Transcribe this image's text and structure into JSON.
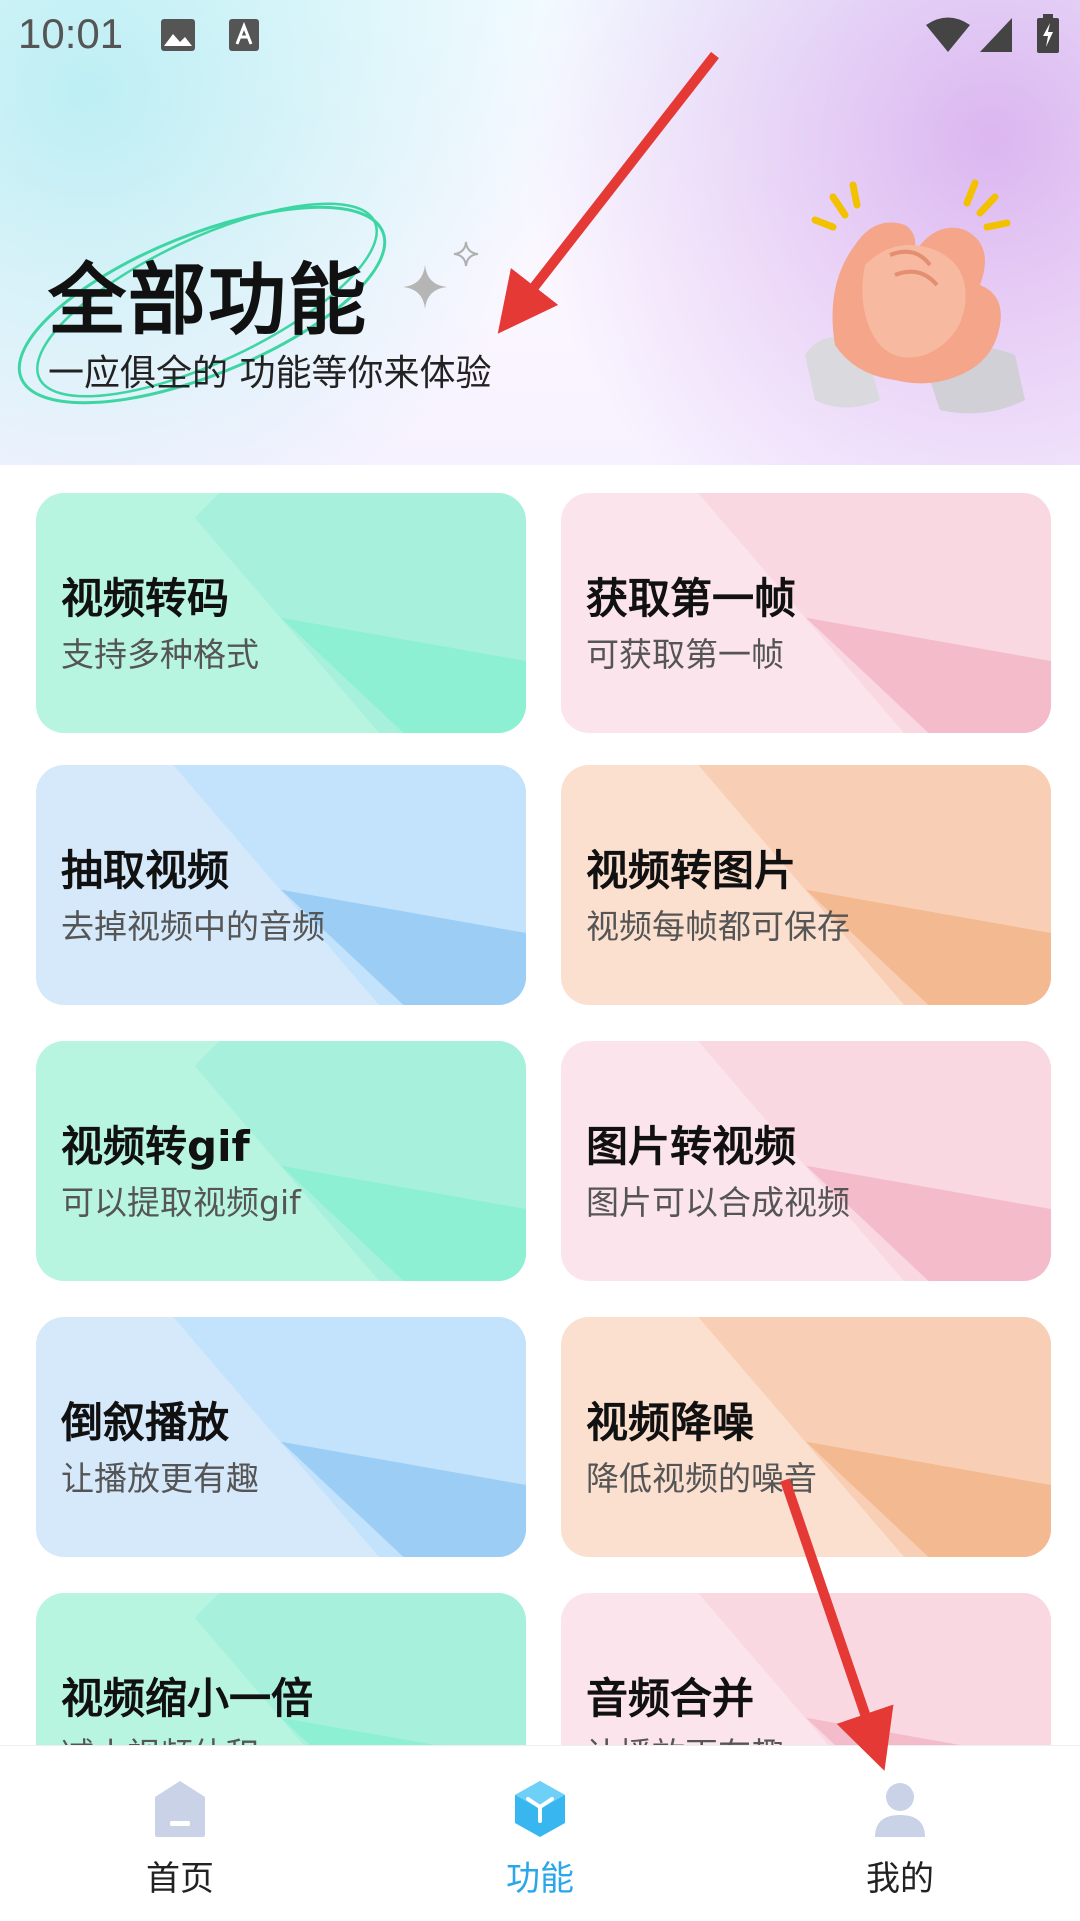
{
  "status_bar": {
    "time": "10:01"
  },
  "header": {
    "title": "全部功能",
    "subtitle": "一应俱全的 功能等你来体验"
  },
  "cards": [
    {
      "title": "视频转码",
      "subtitle": "支持多种格式",
      "theme": "green"
    },
    {
      "title": "获取第一帧",
      "subtitle": "可获取第一帧",
      "theme": "pink"
    },
    {
      "title": "抽取视频",
      "subtitle": "去掉视频中的音频",
      "theme": "blue"
    },
    {
      "title": "视频转图片",
      "subtitle": "视频每帧都可保存",
      "theme": "orange"
    },
    {
      "title": "视频转gif",
      "subtitle": "可以提取视频gif",
      "theme": "green"
    },
    {
      "title": "图片转视频",
      "subtitle": "图片可以合成视频",
      "theme": "pink"
    },
    {
      "title": "倒叙播放",
      "subtitle": "让播放更有趣",
      "theme": "blue"
    },
    {
      "title": "视频降噪",
      "subtitle": "降低视频的噪音",
      "theme": "orange"
    },
    {
      "title": "视频缩小一倍",
      "subtitle": "减小视频体积",
      "theme": "green"
    },
    {
      "title": "音频合并",
      "subtitle": "让播放更有趣",
      "theme": "pink"
    }
  ],
  "bottom_nav": {
    "items": [
      {
        "label": "首页",
        "icon": "home-icon"
      },
      {
        "label": "功能",
        "icon": "cube-icon",
        "active": true
      },
      {
        "label": "我的",
        "icon": "user-icon"
      }
    ]
  },
  "colors": {
    "accent": "#2aa7e8",
    "annotation_arrow": "#e53935"
  }
}
